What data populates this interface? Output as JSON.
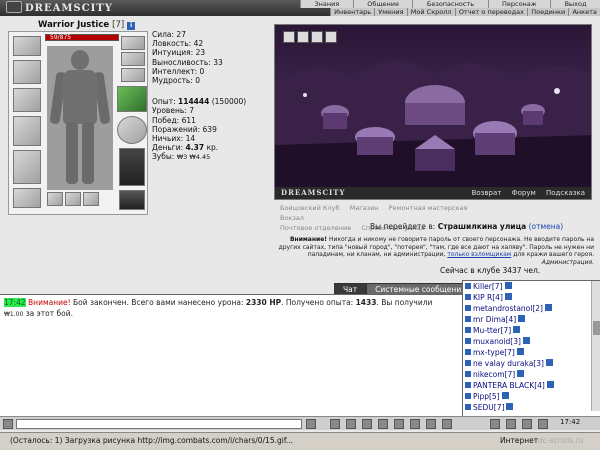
{
  "topbar": {
    "logo": "DREAMSCITY",
    "menu": [
      "Знания",
      "Общение",
      "Безопасность",
      "Персонаж",
      "Выход"
    ],
    "submenu": [
      "Инвентарь",
      "Умения",
      "Мой Скролл",
      "Отчет о переводах",
      "Поединки",
      "Анкета"
    ]
  },
  "character": {
    "name": "Warrior Justice",
    "level": "[7]",
    "hp": "59/875",
    "stats": [
      {
        "label": "Сила:",
        "value": "27"
      },
      {
        "label": "Ловкость:",
        "value": "42"
      },
      {
        "label": "Интуиция:",
        "value": "23"
      },
      {
        "label": "Выносливость:",
        "value": "33"
      },
      {
        "label": "Интеллект:",
        "value": "0"
      },
      {
        "label": "Мудрость:",
        "value": "0"
      }
    ],
    "exp_label": "Опыт:",
    "exp_value": "114444",
    "exp_next": "(150000)",
    "level_label": "Уровень:",
    "level_value": "7",
    "wins_label": "Побед:",
    "wins_value": "611",
    "losses_label": "Поражений:",
    "losses_value": "639",
    "draws_label": "Ничьих:",
    "draws_value": "14",
    "money_label": "Деньги:",
    "money_value": "4.37",
    "money_unit": "кр.",
    "teeth_label": "Зубы:",
    "teeth_value": "₩3 ₩4.45"
  },
  "scene": {
    "brand": "DREAMSCITY",
    "links": [
      "Возврат",
      "Форум",
      "Подсказка"
    ]
  },
  "locations": [
    "Бойцовский Клуб",
    "Магазин",
    "Ремонтная мастерская",
    "Вокзал",
    "Почтовое отделение",
    "Справочная улица"
  ],
  "goto": {
    "prefix": "Вы перейдете в:",
    "target": "Страшилкина улица",
    "cancel": "(отмена)"
  },
  "warning": {
    "title": "Внимание!",
    "line1": "Никогда и никому не говорите пароль от своего персонажа. Не вводите пароль на",
    "line2": "других сайтах, типа \"новый город\", \"потерея\", \"там, где все дают на халяву\". Пароль не нужен ни",
    "line3": "паладинам, ни кланам, ни администрации,",
    "line3_link": "только взломщикам",
    "line3_end": "для кражи вашего героя.",
    "sign": "Администрация."
  },
  "online": "Сейчас в клубе 3437 чел.",
  "tabs": [
    "Чат",
    "Системные сообщения"
  ],
  "chat": {
    "time": "17:42",
    "warn": "Внимание!",
    "text1": "Бой закончен. Всего вами нанесено урона:",
    "dmg": "2330 HP",
    "text2": ". Получено опыта:",
    "exp": "1433",
    "text3": ". Вы получили",
    "reward": "₩1.00",
    "text4": "за этот бой."
  },
  "users": [
    {
      "name": "Killer",
      "lvl": "[7]"
    },
    {
      "name": "KIP R",
      "lvl": "[4]"
    },
    {
      "name": "metandrostanol",
      "lvl": "[2]"
    },
    {
      "name": "mr Dima",
      "lvl": "[4]"
    },
    {
      "name": "Mu-tter",
      "lvl": "[7]"
    },
    {
      "name": "muxanoid",
      "lvl": "[3]"
    },
    {
      "name": "mx-type",
      "lvl": "[7]"
    },
    {
      "name": "ne valay duraka",
      "lvl": "[3]"
    },
    {
      "name": "nikecom",
      "lvl": "[7]"
    },
    {
      "name": "PANTERA BLACK",
      "lvl": "[4]"
    },
    {
      "name": "Pipp",
      "lvl": "[5]"
    },
    {
      "name": "SEDU",
      "lvl": "[7]"
    }
  ],
  "bottom": {
    "clock": "17:42"
  },
  "status": {
    "message": "(Осталось: 1) Загрузка рисунка http://img.combats.com/i/chars/0/15.gif...",
    "zone": "Интернет",
    "watermark": "dc-scrolls.ru"
  },
  "colors": {
    "accent": "#2d62b4",
    "hp": "#b40000",
    "chat_time_bg": "#2ee94a",
    "warning": "#c00000"
  }
}
